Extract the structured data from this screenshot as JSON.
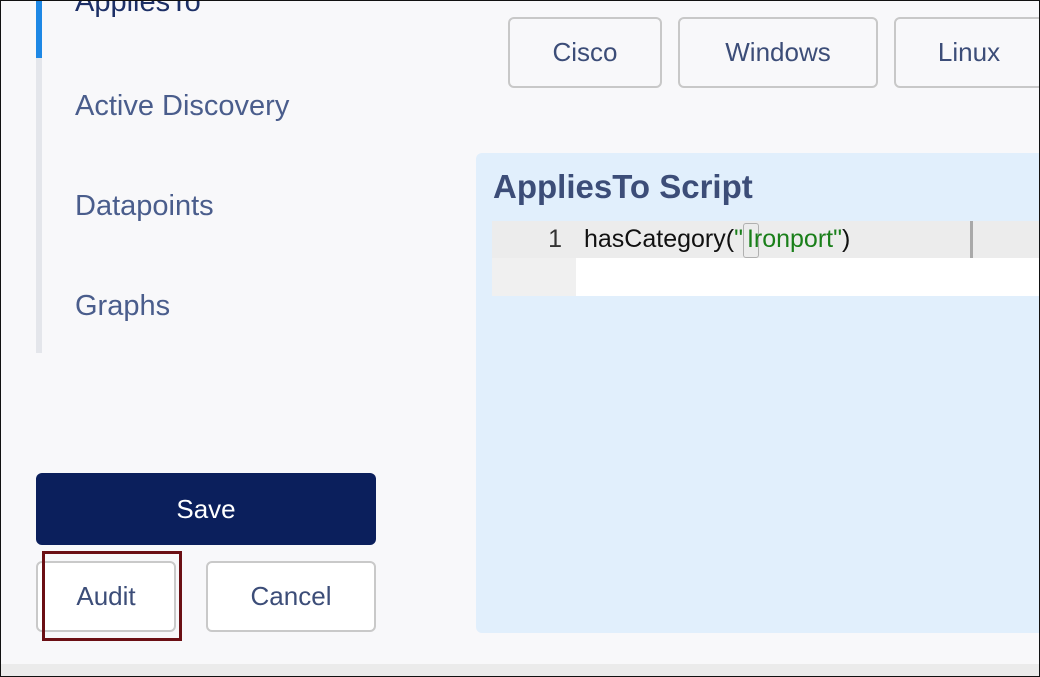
{
  "nav": {
    "active": "AppliesTo",
    "items": [
      "Active Discovery",
      "Datapoints",
      "Graphs"
    ]
  },
  "templates": [
    "Cisco",
    "Windows",
    "Linux"
  ],
  "script": {
    "title": "AppliesTo Script",
    "line_number": "1",
    "code_fn": "hasCategory(",
    "code_q1": "\"",
    "code_str": "Ironport",
    "code_q2": "\"",
    "code_end": ")"
  },
  "actions": {
    "save": "Save",
    "audit": "Audit",
    "cancel": "Cancel"
  },
  "colors": {
    "primary": "#0b1f5c",
    "active_indicator": "#1e88e5",
    "panel_bg": "#e1effc",
    "string_green": "#1a7f1a",
    "highlight_border": "#6b0f14"
  }
}
